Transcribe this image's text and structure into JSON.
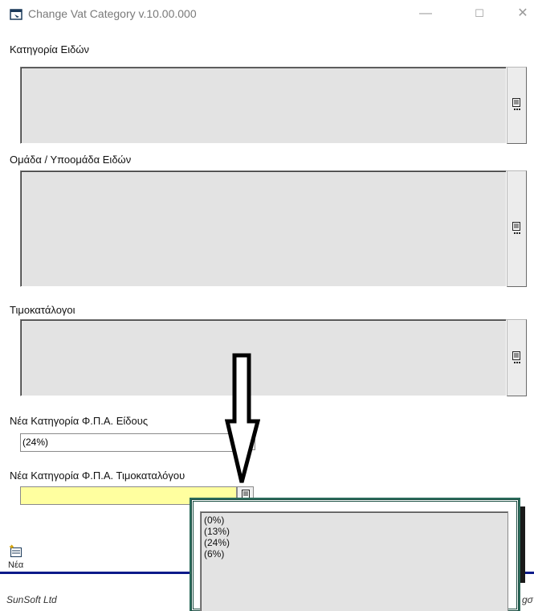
{
  "window": {
    "title": "Change Vat Category v.10.00.000",
    "minimize": "—",
    "maximize": "☐",
    "close": "✕"
  },
  "sections": {
    "item_category_label": "Κατηγορία Ειδών",
    "item_group_label": "Ομάδα / Υποομάδα Ειδών",
    "price_lists_label": "Τιμοκατάλογοι",
    "new_vat_item_label": "Νέα Κατηγορία Φ.Π.Α. Είδους",
    "new_vat_item_value": "(24%)",
    "new_vat_pricelist_label": "Νέα Κατηγορία Φ.Π.Α. Τιμοκαταλόγου",
    "new_vat_pricelist_value": ""
  },
  "dropdown": {
    "options": [
      "(0%)",
      "(13%)",
      "(24%)",
      "(6%)"
    ]
  },
  "toolbar": {
    "new_label": "Νέα"
  },
  "footer": {
    "company": "SunSoft Ltd",
    "right_fragment": "gσ"
  },
  "colors": {
    "field_highlight": "#ffff9f",
    "footer_line": "#0a1a8a",
    "popup_border": "#1e4f44"
  }
}
